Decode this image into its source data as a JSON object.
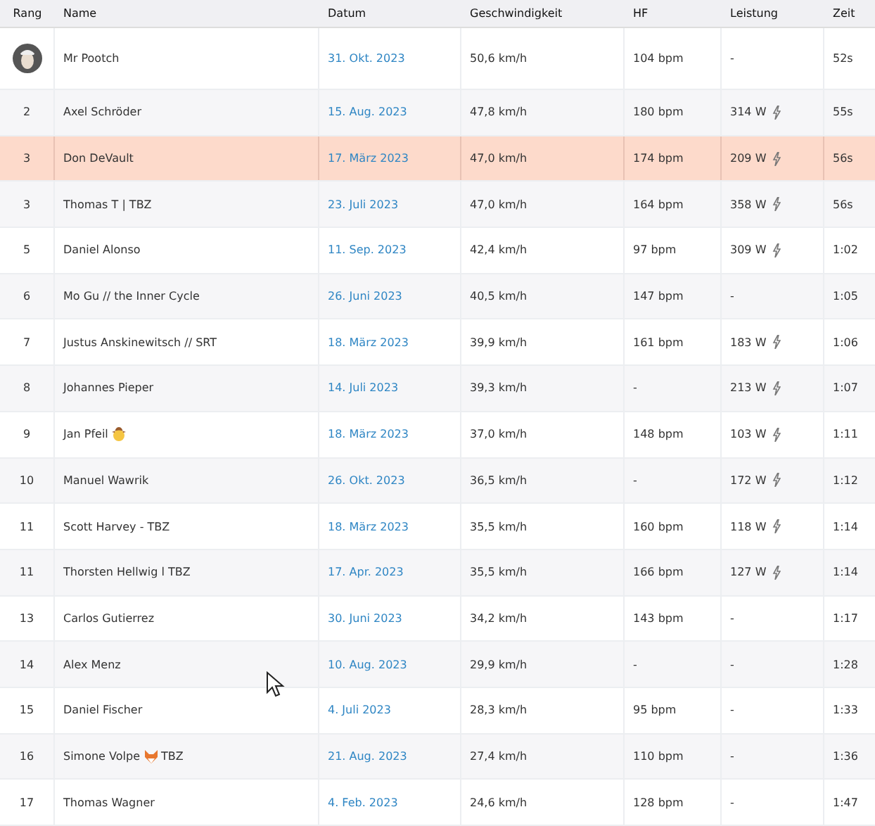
{
  "table": {
    "columns": [
      "Rang",
      "Name",
      "Datum",
      "Geschwindigkeit",
      "HF",
      "Leistung",
      "Zeit"
    ],
    "rows": [
      {
        "avatar": true,
        "rank": "",
        "name": "Mr Pootch",
        "date": "31. Okt. 2023",
        "speed": "50,6 km/h",
        "hr": "104 bpm",
        "power": "-",
        "bolt": false,
        "time": "52s",
        "selected": false
      },
      {
        "avatar": false,
        "rank": "2",
        "name": "Axel Schröder",
        "date": "15. Aug. 2023",
        "speed": "47,8 km/h",
        "hr": "180 bpm",
        "power": "314 W",
        "bolt": true,
        "time": "55s",
        "selected": false
      },
      {
        "avatar": false,
        "rank": "3",
        "name": "Don DeVault",
        "date": "17. März 2023",
        "speed": "47,0 km/h",
        "hr": "174 bpm",
        "power": "209 W",
        "bolt": true,
        "time": "56s",
        "selected": true
      },
      {
        "avatar": false,
        "rank": "3",
        "name": "Thomas T | TBZ",
        "date": "23. Juli 2023",
        "speed": "47,0 km/h",
        "hr": "164 bpm",
        "power": "358 W",
        "bolt": true,
        "time": "56s",
        "selected": false
      },
      {
        "avatar": false,
        "rank": "5",
        "name": "Daniel Alonso",
        "date": "11. Sep. 2023",
        "speed": "42,4 km/h",
        "hr": "97 bpm",
        "power": "309 W",
        "bolt": true,
        "time": "1:02",
        "selected": false
      },
      {
        "avatar": false,
        "rank": "6",
        "name": "Mo Gu // the Inner Cycle",
        "date": "26. Juni 2023",
        "speed": "40,5 km/h",
        "hr": "147 bpm",
        "power": "-",
        "bolt": false,
        "time": "1:05",
        "selected": false
      },
      {
        "avatar": false,
        "rank": "7",
        "name": "Justus Anskinewitsch // SRT",
        "date": "18. März 2023",
        "speed": "39,9 km/h",
        "hr": "161 bpm",
        "power": "183 W",
        "bolt": true,
        "time": "1:06",
        "selected": false
      },
      {
        "avatar": false,
        "rank": "8",
        "name": "Johannes Pieper",
        "date": "14. Juli 2023",
        "speed": "39,3 km/h",
        "hr": "-",
        "power": "213 W",
        "bolt": true,
        "time": "1:07",
        "selected": false
      },
      {
        "avatar": false,
        "rank": "9",
        "name": "Jan Pfeil",
        "name_icon": {
          "kind": "cowboy"
        },
        "date": "18. März 2023",
        "speed": "37,0 km/h",
        "hr": "148 bpm",
        "power": "103 W",
        "bolt": true,
        "time": "1:11",
        "selected": false
      },
      {
        "avatar": false,
        "rank": "10",
        "name": "Manuel Wawrik",
        "date": "26. Okt. 2023",
        "speed": "36,5 km/h",
        "hr": "-",
        "power": "172 W",
        "bolt": true,
        "time": "1:12",
        "selected": false
      },
      {
        "avatar": false,
        "rank": "11",
        "name": "Scott Harvey - TBZ",
        "date": "18. März 2023",
        "speed": "35,5 km/h",
        "hr": "160 bpm",
        "power": "118 W",
        "bolt": true,
        "time": "1:14",
        "selected": false
      },
      {
        "avatar": false,
        "rank": "11",
        "name": "Thorsten Hellwig l TBZ",
        "date": "17. Apr. 2023",
        "speed": "35,5 km/h",
        "hr": "166 bpm",
        "power": "127 W",
        "bolt": true,
        "time": "1:14",
        "selected": false
      },
      {
        "avatar": false,
        "rank": "13",
        "name": "Carlos Gutierrez",
        "date": "30. Juni 2023",
        "speed": "34,2 km/h",
        "hr": "143 bpm",
        "power": "-",
        "bolt": false,
        "time": "1:17",
        "selected": false
      },
      {
        "avatar": false,
        "rank": "14",
        "name": "Alex Menz",
        "date": "10. Aug. 2023",
        "speed": "29,9 km/h",
        "hr": "-",
        "power": "-",
        "bolt": false,
        "time": "1:28",
        "selected": false
      },
      {
        "avatar": false,
        "rank": "15",
        "name": "Daniel Fischer",
        "date": "4. Juli 2023",
        "speed": "28,3 km/h",
        "hr": "95 bpm",
        "power": "-",
        "bolt": false,
        "time": "1:33",
        "selected": false
      },
      {
        "avatar": false,
        "rank": "16",
        "name": "Simone Volpe",
        "name_icon": {
          "kind": "fox"
        },
        "name_suffix": "TBZ",
        "date": "21. Aug. 2023",
        "speed": "27,4 km/h",
        "hr": "110 bpm",
        "power": "-",
        "bolt": false,
        "time": "1:36",
        "selected": false
      },
      {
        "avatar": false,
        "rank": "17",
        "name": "Thomas Wagner",
        "date": "4. Feb. 2023",
        "speed": "24,6 km/h",
        "hr": "128 bpm",
        "power": "-",
        "bolt": false,
        "time": "1:47",
        "selected": false
      }
    ]
  }
}
